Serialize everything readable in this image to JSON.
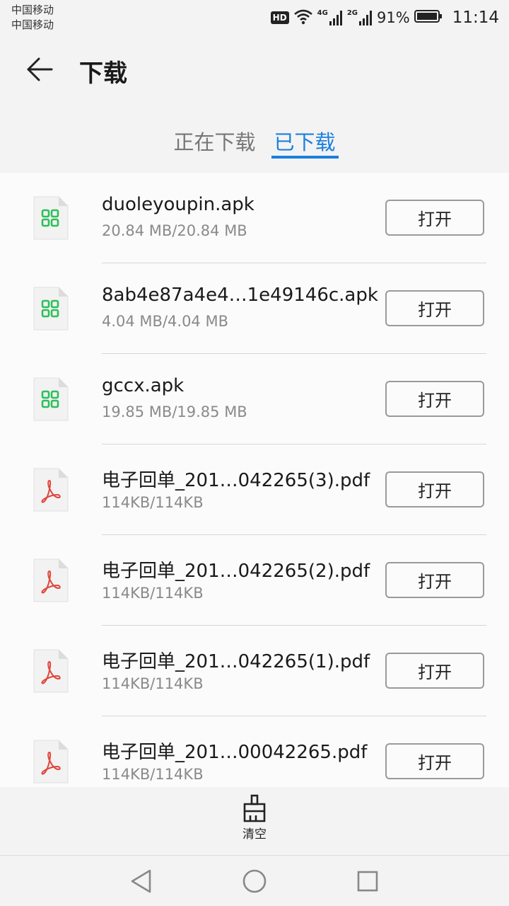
{
  "status_bar": {
    "carrier_1": "中国移动",
    "carrier_2": "中国移动",
    "hd": "HD",
    "net_1": "4G",
    "net_2": "2G",
    "battery": "91%",
    "time": "11:14"
  },
  "header": {
    "title": "下载"
  },
  "tabs": [
    {
      "label": "正在下载",
      "active": false
    },
    {
      "label": "已下载",
      "active": true
    }
  ],
  "files": [
    {
      "name": "duoleyoupin.apk",
      "size": "20.84 MB/20.84 MB",
      "icon": "apk-file-icon",
      "action": "打开"
    },
    {
      "name": "8ab4e87a4e4…1e49146c.apk",
      "size": "4.04 MB/4.04 MB",
      "icon": "apk-file-icon",
      "action": "打开"
    },
    {
      "name": "gccx.apk",
      "size": "19.85 MB/19.85 MB",
      "icon": "apk-file-icon",
      "action": "打开"
    },
    {
      "name": "电子回单_201…042265(3).pdf",
      "size": "114KB/114KB",
      "icon": "pdf-file-icon",
      "action": "打开"
    },
    {
      "name": "电子回单_201…042265(2).pdf",
      "size": "114KB/114KB",
      "icon": "pdf-file-icon",
      "action": "打开"
    },
    {
      "name": "电子回单_201…042265(1).pdf",
      "size": "114KB/114KB",
      "icon": "pdf-file-icon",
      "action": "打开"
    },
    {
      "name": "电子回单_201…00042265.pdf",
      "size": "114KB/114KB",
      "icon": "pdf-file-icon",
      "action": "打开"
    }
  ],
  "toolbar": {
    "clear_label": "清空"
  },
  "colors": {
    "accent": "#1b7fdf",
    "apk_green": "#2dbf5a",
    "pdf_red": "#e0463c"
  }
}
